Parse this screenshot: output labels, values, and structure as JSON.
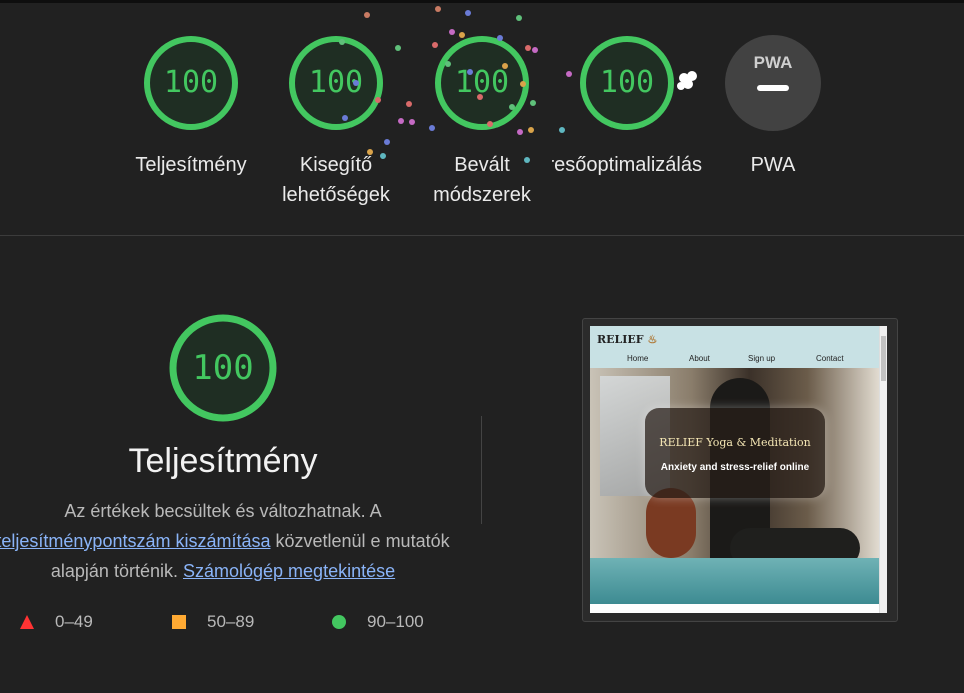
{
  "gauges": [
    {
      "score": "100",
      "label": "Teljesítmény"
    },
    {
      "score": "100",
      "label": "Kisegítő lehetőségek"
    },
    {
      "score": "100",
      "label": "Bevált módszerek"
    },
    {
      "score": "100",
      "label": "Keresőoptimalizálás"
    },
    {
      "score": "PWA",
      "label": "PWA"
    }
  ],
  "performance": {
    "score": "100",
    "title": "Teljesítmény",
    "desc_prefix": "Az értékek becsültek és változhatnak. A ",
    "desc_link1": "teljesítménypontszám kiszámítása",
    "desc_middle": " közvetlenül e mutatók alapján történik. ",
    "desc_link2": "Számológép megtekintése"
  },
  "legend": [
    {
      "range": "0–49",
      "color": "#f33"
    },
    {
      "range": "50–89",
      "color": "#fa3"
    },
    {
      "range": "90–100",
      "color": "#43c760"
    }
  ],
  "screenshot": {
    "logo": "RELIEF",
    "nav": [
      "Home",
      "About",
      "Sign up",
      "Contact"
    ],
    "hero_title": "RELIEF Yoga & Meditation",
    "hero_subtitle": "Anxiety and stress-relief online"
  },
  "colors": {
    "pass": "#43c760",
    "pass_bg": "#1f3a27",
    "pwa_bg": "#424242",
    "background": "#212121"
  }
}
